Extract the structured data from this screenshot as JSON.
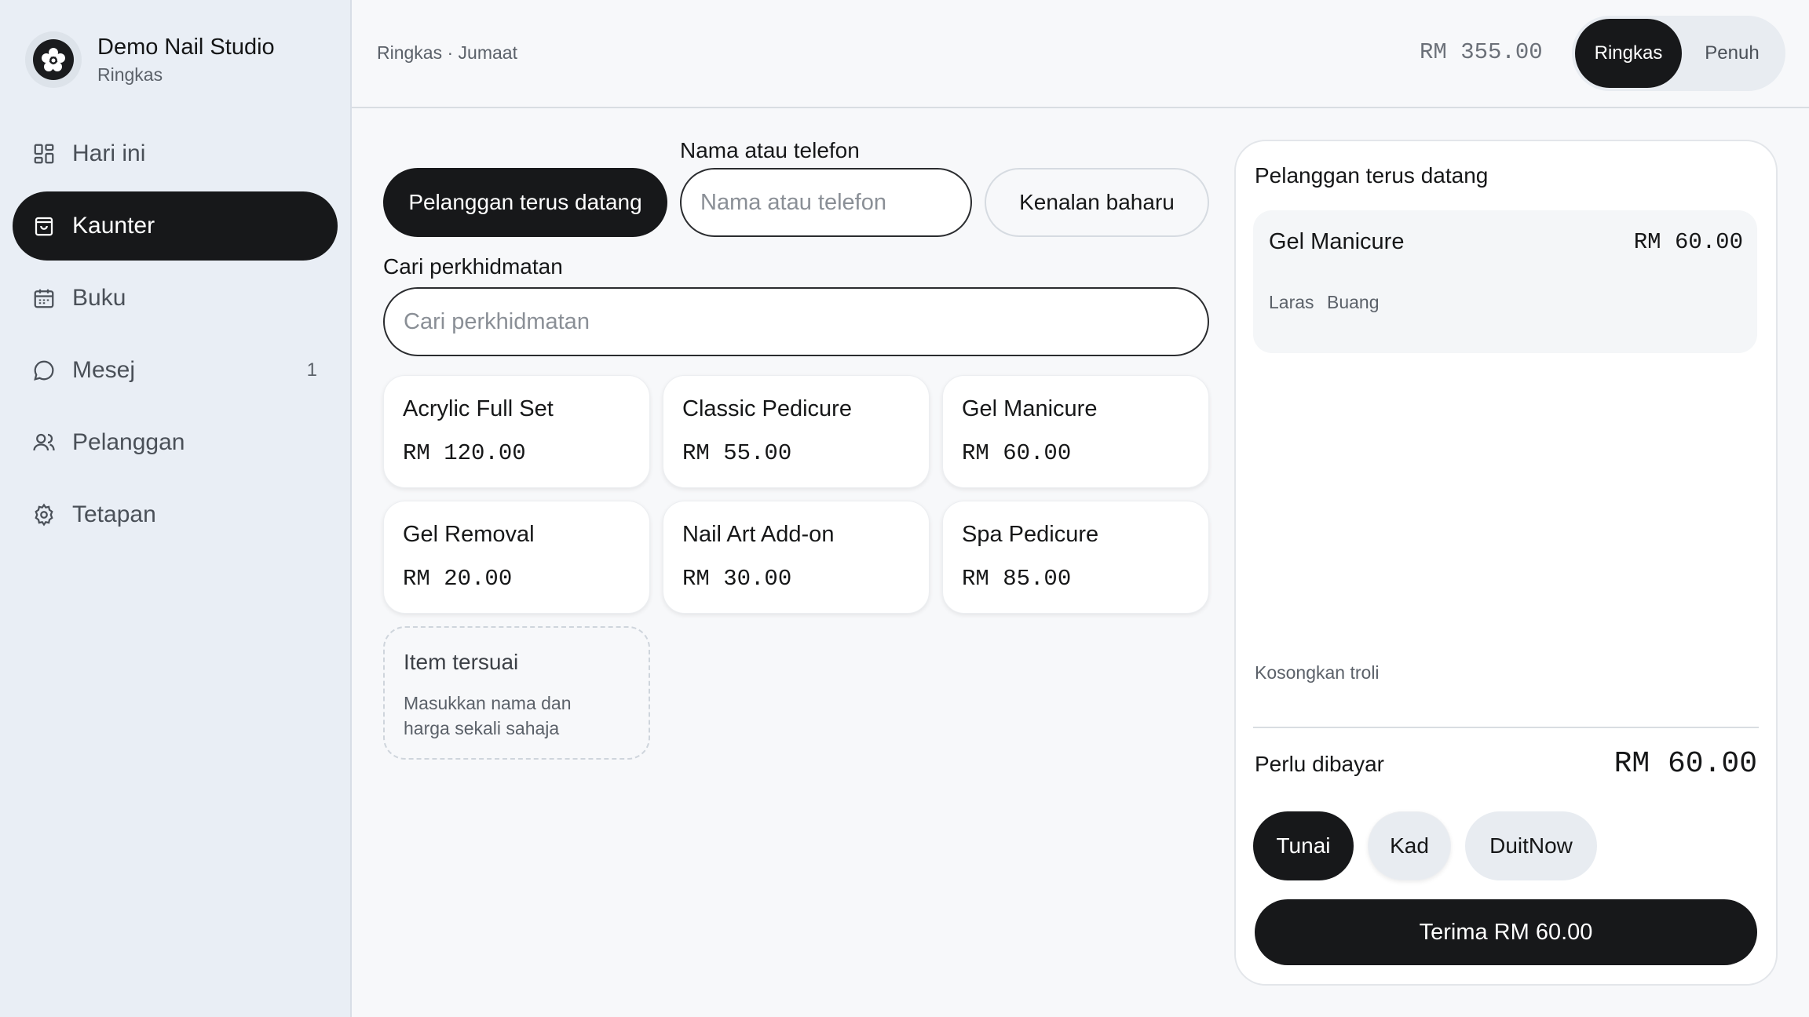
{
  "brand": {
    "name": "Demo Nail Studio",
    "subtitle": "Ringkas"
  },
  "sidebar": {
    "items": [
      {
        "label": "Hari ini",
        "icon": "dashboard-icon"
      },
      {
        "label": "Kaunter",
        "icon": "shopping-bag-icon",
        "active": true
      },
      {
        "label": "Buku",
        "icon": "calendar-icon"
      },
      {
        "label": "Mesej",
        "icon": "chat-bubble-icon",
        "badge": "1"
      },
      {
        "label": "Pelanggan",
        "icon": "users-icon"
      },
      {
        "label": "Tetapan",
        "icon": "gear-icon"
      }
    ]
  },
  "topbar": {
    "breadcrumb": "Ringkas · Jumaat",
    "total": "RM 355.00",
    "mode_compact": "Ringkas",
    "mode_full": "Penuh"
  },
  "customer": {
    "label": "Nama atau telefon",
    "returning_button": "Pelanggan terus datang",
    "input_placeholder": "Nama atau telefon",
    "new_button": "Kenalan baharu"
  },
  "service_search": {
    "label": "Cari perkhidmatan",
    "placeholder": "Cari perkhidmatan"
  },
  "services": [
    {
      "name": "Acrylic Full Set",
      "price": "RM 120.00"
    },
    {
      "name": "Classic Pedicure",
      "price": "RM 55.00"
    },
    {
      "name": "Gel Manicure",
      "price": "RM 60.00"
    },
    {
      "name": "Gel Removal",
      "price": "RM 20.00"
    },
    {
      "name": "Nail Art Add-on",
      "price": "RM 30.00"
    },
    {
      "name": "Spa Pedicure",
      "price": "RM 85.00"
    }
  ],
  "custom_item": {
    "title": "Item tersuai",
    "subtitle": "Masukkan nama dan harga sekali sahaja"
  },
  "cart": {
    "title": "Pelanggan terus datang",
    "items": [
      {
        "name": "Gel Manicure",
        "price": "RM 60.00",
        "staff": "Laras",
        "remove": "Buang"
      }
    ],
    "clear_label": "Kosongkan troli",
    "due_label": "Perlu dibayar",
    "due_amount": "RM 60.00",
    "payment_methods": [
      "Tunai",
      "Kad",
      "DuitNow"
    ],
    "selected_payment": "Tunai",
    "accept_label": "Terima RM 60.00"
  },
  "colors": {
    "primary": "#17181a",
    "sidebar_bg": "#e9eef5",
    "page_bg": "#f7f8fa"
  }
}
